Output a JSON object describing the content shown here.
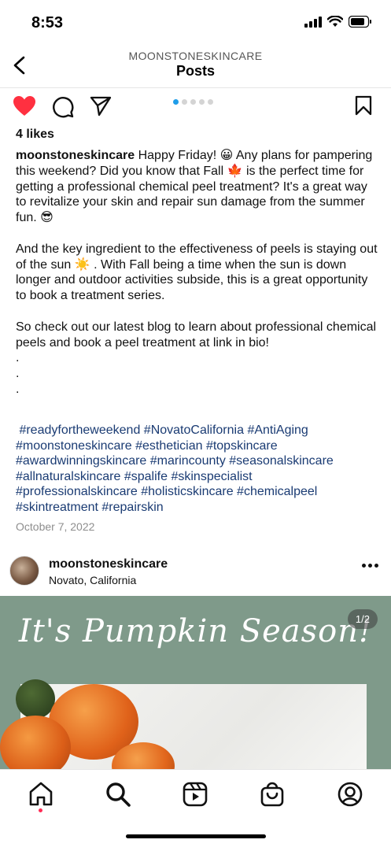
{
  "status": {
    "time": "8:53"
  },
  "header": {
    "account": "MOONSTONESKINCARE",
    "title": "Posts"
  },
  "carousel": {
    "dots": 5,
    "active": 0
  },
  "post": {
    "likes": "4 likes",
    "username": "moonstoneskincare",
    "caption_p1": " Happy Friday! 😀 Any plans for pampering this weekend? Did you know that Fall 🍁 is the perfect time for getting a professional chemical peel treatment? It's a great way to revitalize your skin and repair sun damage from the summer fun. 😎",
    "caption_p2": "And the key ingredient to the effectiveness of peels is staying out of the sun ☀️ . With Fall being a time when the sun is down longer and outdoor activities subside, this is a great opportunity to book a treatment series.",
    "caption_p3": "So check out our latest blog to learn about professional chemical peels and book a peel treatment at link in bio!",
    "dot1": ".",
    "dot2": ".",
    "dot3": ".",
    "hashtags": [
      "#readyfortheweekend",
      "#NovatoCalifornia",
      "#AntiAging",
      "#moonstoneskincare",
      "#esthetician",
      "#topskincare",
      "#awardwinningskincare",
      "#marincounty",
      "#seasonalskincare",
      "#allnaturalskincare",
      "#spalife",
      "#skinspecialist",
      "#professionalskincare",
      "#holisticskincare",
      "#chemicalpeel",
      "#skintreatment",
      "#repairskin"
    ],
    "date": "October 7, 2022"
  },
  "next_post": {
    "username": "moonstoneskincare",
    "location": "Novato, California",
    "image_title": "It's Pumpkin Season!",
    "counter": "1/2"
  },
  "colors": {
    "heart": "#ff3040",
    "accent": "#1f9de9",
    "hashtag": "#1a3b73",
    "image_bg": "#7f9a8a"
  },
  "icons": {
    "back": "chevron-left-icon",
    "like": "heart-icon",
    "comment": "comment-icon",
    "share": "paper-plane-icon",
    "save": "bookmark-icon",
    "more": "more-icon",
    "home": "home-icon",
    "search": "search-icon",
    "reels": "reels-icon",
    "shop": "shopping-bag-icon",
    "profile": "profile-icon"
  }
}
